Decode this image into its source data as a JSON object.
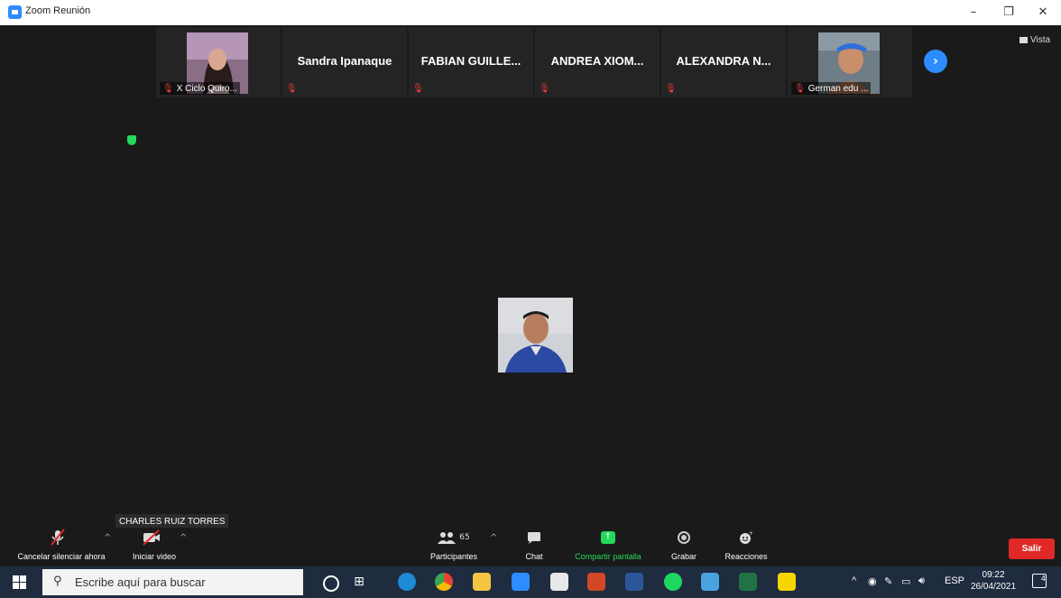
{
  "window": {
    "title": "Zoom Reunión",
    "controls": {
      "minimize": "–",
      "restore": "❐",
      "close": "✕"
    }
  },
  "gallery": {
    "tiles": [
      {
        "name": "X Ciclo Quiro...",
        "has_video": true,
        "muted": true
      },
      {
        "name": "Sandra Ipanaque",
        "has_video": false,
        "muted": true
      },
      {
        "name": "FABIAN GUILLE...",
        "has_video": false,
        "muted": true
      },
      {
        "name": "ANDREA XIOM...",
        "has_video": false,
        "muted": true
      },
      {
        "name": "ALEXANDRA N...",
        "has_video": false,
        "muted": true
      },
      {
        "name": "German edu ...",
        "has_video": true,
        "muted": true
      }
    ],
    "next_icon": "chevron-right-icon",
    "view_label": "Vista"
  },
  "speaker": {
    "name_tag": "CHARLES RUIZ TORRES"
  },
  "toolbar": {
    "unmute_label": "Cancelar silenciar ahora",
    "start_video_label": "Iniciar video",
    "participants_label": "Participantes",
    "participants_count": "65",
    "chat_label": "Chat",
    "share_label": "Compartir pantalla",
    "record_label": "Grabar",
    "reactions_label": "Reacciones",
    "exit_label": "Salir",
    "caret": "^"
  },
  "taskbar": {
    "search_placeholder": "Escribe aquí para buscar",
    "language": "ESP",
    "time": "09:22",
    "date": "26/04/2021",
    "notification_count": "4"
  },
  "colors": {
    "zoom_blue": "#2d8cff",
    "share_green": "#23d959",
    "exit_red": "#e02828",
    "taskbar": "#1f2b3f"
  }
}
